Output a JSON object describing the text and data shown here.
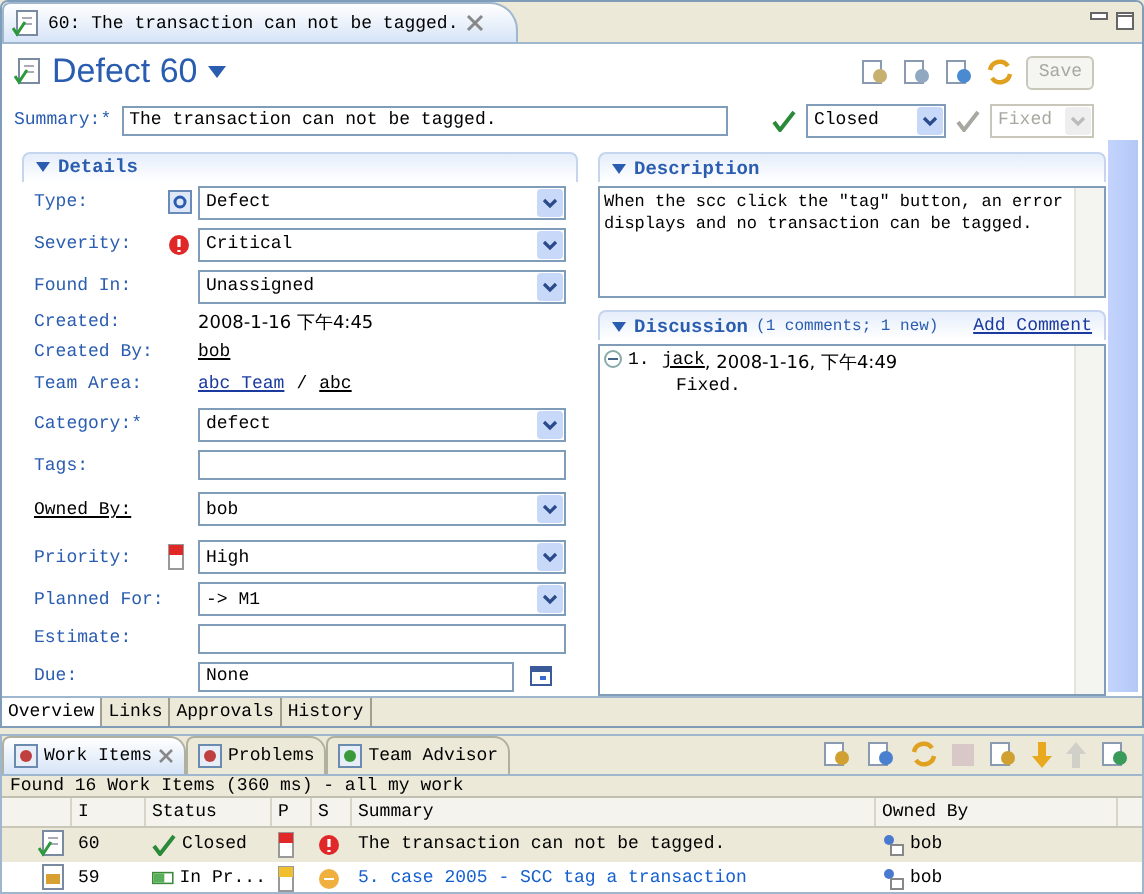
{
  "editor_tab": {
    "title": "60: The transaction can not be tagged."
  },
  "header": {
    "title": "Defect 60",
    "save_button": {
      "label": "Save",
      "disabled": true
    }
  },
  "summary": {
    "label": "Summary:*",
    "value": "The transaction can not be tagged.",
    "state": "Closed",
    "resolution": {
      "value": "Fixed",
      "disabled": true
    }
  },
  "details": {
    "title": "Details",
    "fields": [
      {
        "kind": "select",
        "label": "Type:",
        "value": "Defect"
      },
      {
        "kind": "select",
        "label": "Severity:",
        "value": "Critical"
      },
      {
        "kind": "select",
        "label": "Found In:",
        "value": "Unassigned"
      },
      {
        "kind": "text",
        "label": "Created:",
        "value": "2008-1-16 下午4:45"
      },
      {
        "kind": "link",
        "label": "Created By:",
        "value": "bob"
      },
      {
        "kind": "links",
        "label": "Team Area:",
        "values": [
          "abc Team",
          "abc"
        ],
        "separator": "/"
      },
      {
        "kind": "select",
        "label": "Category:*",
        "value": "defect"
      },
      {
        "kind": "input",
        "label": "Tags:"
      },
      {
        "kind": "select",
        "label": "Owned By:",
        "value": "bob",
        "label_link": true
      },
      {
        "kind": "select",
        "label": "Priority:",
        "value": "High"
      },
      {
        "kind": "select",
        "label": "Planned For:",
        "value": "-> M1"
      },
      {
        "kind": "input",
        "label": "Estimate:"
      },
      {
        "kind": "date",
        "label": "Due:",
        "value": "None"
      }
    ]
  },
  "description": {
    "title": "Description",
    "text": "When the scc click the \"tag\" button, an error displays and no transaction can be tagged."
  },
  "discussion": {
    "title": "Discussion",
    "count": "(1 comments; 1 new)",
    "add_comment": "Add Comment",
    "comments": [
      {
        "number": "1.",
        "author": "jack",
        "after_author": ", 2008-1-16, 下午4:49",
        "text": "Fixed.",
        "expanded": true
      }
    ]
  },
  "editor_pages": [
    {
      "label": "Overview",
      "selected": true
    },
    {
      "label": "Links",
      "selected": false
    },
    {
      "label": "Approvals",
      "selected": false
    },
    {
      "label": "History",
      "selected": false
    }
  ],
  "view_tabs": [
    {
      "label": "Work Items",
      "selected": true
    },
    {
      "label": "Problems",
      "selected": false
    },
    {
      "label": "Team Advisor",
      "selected": false
    }
  ],
  "status_line": "Found 16 Work Items (360 ms) - all my work",
  "table": {
    "columns": [
      "I",
      "Status",
      "P",
      "S",
      "Summary",
      "Owned By"
    ],
    "rows": [
      {
        "kind": "defect",
        "id": "60",
        "status": {
          "kind": "closed",
          "label": "Closed"
        },
        "priority": {
          "color": "#e02828"
        },
        "severity": {
          "kind": "critical",
          "color": "#e02828"
        },
        "summary": "The transaction can not be tagged.",
        "owner": "bob",
        "selected": true,
        "unread": false
      },
      {
        "kind": "task",
        "id": "59",
        "status": {
          "kind": "in_progress",
          "label": "In Pr..."
        },
        "priority": {
          "color": "#f0c030"
        },
        "severity": {
          "kind": "normal",
          "color": "#f0b040"
        },
        "summary": "5. case 2005 - SCC tag a transaction",
        "owner": "bob",
        "selected": false,
        "unread": true
      }
    ]
  }
}
